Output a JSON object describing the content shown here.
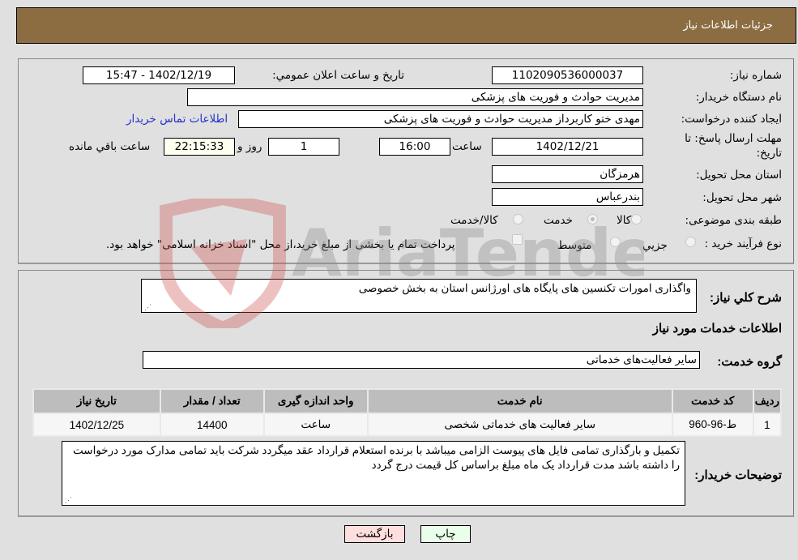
{
  "header": {
    "title": "جزئیات اطلاعات نیاز"
  },
  "form": {
    "need_number": {
      "label": "شماره نیاز:",
      "value": "1102090536000037"
    },
    "announce_datetime": {
      "label": "تاریخ و ساعت اعلان عمومي:",
      "value": "1402/12/19 - 15:47"
    },
    "buyer_org": {
      "label": "نام دستگاه خریدار:",
      "value": "مدیریت حوادث و فوریت های پزشکی"
    },
    "requester": {
      "label": "ایجاد کننده درخواست:",
      "value": "مهدی ختو کاربرداز مدیریت حوادث و فوریت های پزشکی"
    },
    "buyer_contact_link": "اطلاعات تماس خریدار",
    "deadline": {
      "label_line1": "مهلت ارسال پاسخ: تا",
      "label_line2": "تاریخ:",
      "date": "1402/12/21",
      "time_label": "ساعت",
      "time": "16:00",
      "days": "1",
      "days_label": "روز و",
      "remaining": "22:15:33",
      "remaining_label": "ساعت باقي مانده"
    },
    "province": {
      "label": "استان محل تحویل:",
      "value": "هرمزگان"
    },
    "city": {
      "label": "شهر محل تحویل:",
      "value": "بندرعباس"
    },
    "category": {
      "label": "طبقه بندی موضوعی:",
      "options": [
        "کالا",
        "خدمت",
        "کالا/خدمت"
      ],
      "selected": "خدمت"
    },
    "purchase_type": {
      "label": "نوع فرآیند خرید :",
      "options": [
        "جزيي",
        "متوسط"
      ],
      "selected": "جزيي",
      "treasury_note": "پرداخت تمام یا بخشی از مبلغ خرید،از محل \"اسناد خزانه اسلامی\" خواهد بود."
    }
  },
  "details": {
    "description_label": "شرح كلي نياز:",
    "description": "واگذاری امورات  تکنسین های  پایگاه های اورژانس استان به بخش خصوصی",
    "services_heading": "اطلاعات خدمات مورد نیاز",
    "service_group_label": "گروه خدمت:",
    "service_group": "سایر فعالیت‌های خدماتی",
    "table": {
      "headers": [
        "ردیف",
        "کد خدمت",
        "نام خدمت",
        "واحد اندازه گیری",
        "تعداد / مقدار",
        "تاریخ نیاز"
      ],
      "rows": [
        [
          "1",
          "ط-96-960",
          "سایر فعالیت های خدماتی شخصی",
          "ساعت",
          "14400",
          "1402/12/25"
        ]
      ]
    },
    "buyer_notes_label": "توضیحات خریدار:",
    "buyer_notes": "تکمیل و بارگذاری تمامی  فایل های پیوست الزامی  میباشد با برنده استعلام قرارداد عقد میگردد  شرکت باید تمامی  مدارک مورد درخواست را داشته باشد   مدت قرارداد یک ماه مبلغ براساس کل قیمت درج گردد"
  },
  "buttons": {
    "print": "چاپ",
    "back": "بازگشت"
  },
  "watermark": "AriaTender.neT",
  "colors": {
    "header_bg": "#8c6d42",
    "print_bg": "#eaffea",
    "back_bg": "#ffdede",
    "link": "#2233cc"
  }
}
